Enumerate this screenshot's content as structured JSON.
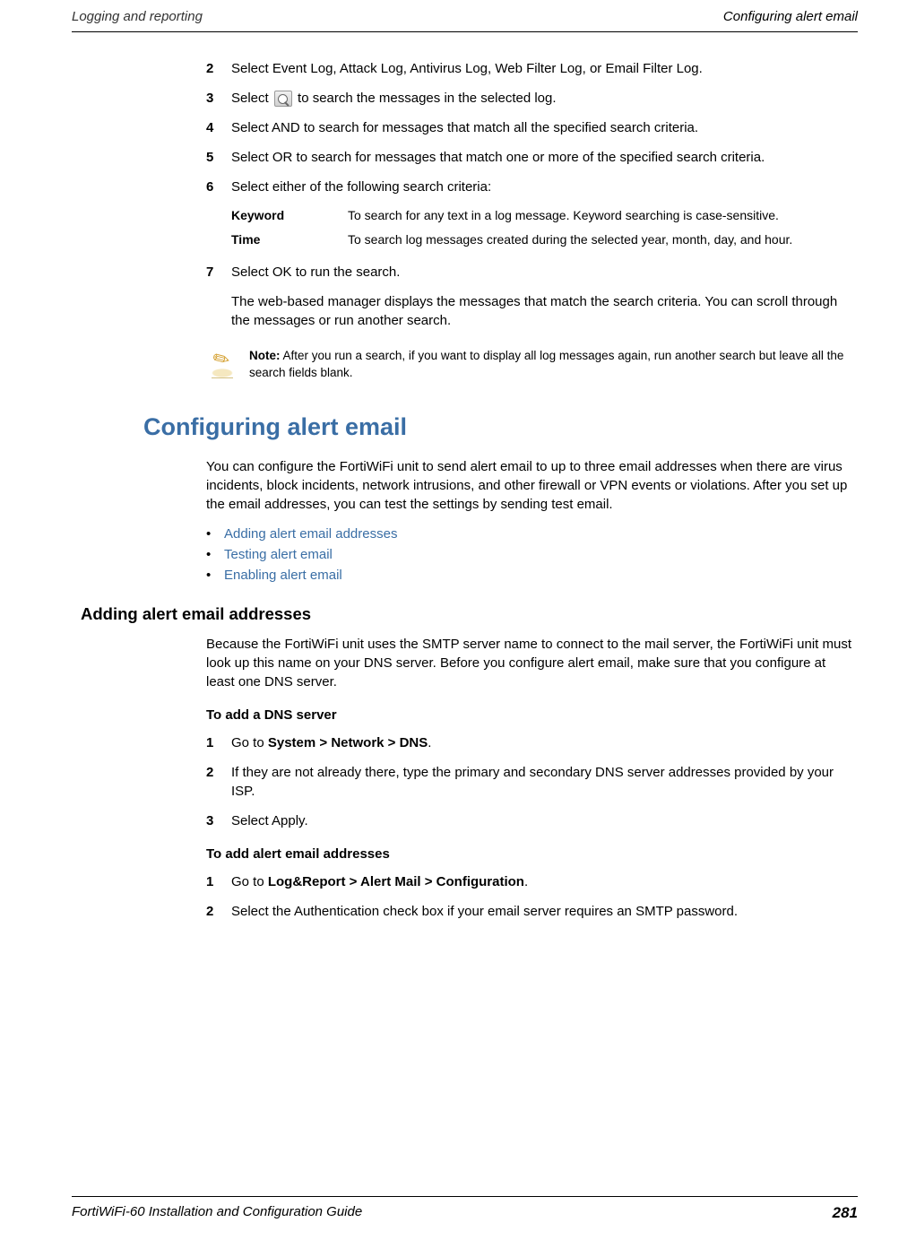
{
  "header": {
    "left": "Logging and reporting",
    "right": "Configuring alert email"
  },
  "steps_top": [
    {
      "num": "2",
      "text": "Select Event Log, Attack Log, Antivirus Log, Web Filter Log, or Email Filter Log."
    },
    {
      "num": "3",
      "text_pre": "Select ",
      "text_post": " to search the messages in the selected log."
    },
    {
      "num": "4",
      "text": "Select AND to search for messages that match all the specified search criteria."
    },
    {
      "num": "5",
      "text": "Select OR to search for messages that match one or more of the specified search criteria."
    },
    {
      "num": "6",
      "text": "Select either of the following search criteria:"
    }
  ],
  "criteria": [
    {
      "label": "Keyword",
      "desc": "To search for any text in a log message. Keyword searching is case-sensitive."
    },
    {
      "label": "Time",
      "desc": "To search log messages created during the selected year, month, day, and hour."
    }
  ],
  "step7": {
    "num": "7",
    "text": "Select OK to run the search.",
    "sub": "The web-based manager displays the messages that match the search criteria. You can scroll through the messages or run another search."
  },
  "note": {
    "label": "Note:",
    "text": " After you run a search, if you want to display all log messages again, run another search but leave all the search fields blank."
  },
  "section": {
    "title": "Configuring alert email",
    "intro": "You can configure the FortiWiFi unit to send alert email to up to three email addresses when there are virus incidents, block incidents, network intrusions, and other firewall or VPN events or violations. After you set up the email addresses, you can test the settings by sending test email.",
    "links": [
      "Adding alert email addresses",
      "Testing alert email",
      "Enabling alert email"
    ]
  },
  "subsection": {
    "title": "Adding alert email addresses",
    "intro": "Because the FortiWiFi unit uses the SMTP server name to connect to the mail server, the FortiWiFi unit must look up this name on your DNS server. Before you configure alert email, make sure that you configure at least one DNS server."
  },
  "proc1": {
    "heading": "To add a DNS server",
    "steps": [
      {
        "num": "1",
        "pre": "Go to ",
        "bold": "System > Network > DNS",
        "post": "."
      },
      {
        "num": "2",
        "text": "If they are not already there, type the primary and secondary DNS server addresses provided by your ISP."
      },
      {
        "num": "3",
        "text": "Select Apply."
      }
    ]
  },
  "proc2": {
    "heading": "To add alert email addresses",
    "steps": [
      {
        "num": "1",
        "pre": "Go to ",
        "bold": "Log&Report > Alert Mail > Configuration",
        "post": "."
      },
      {
        "num": "2",
        "text": "Select the Authentication check box if your email server requires an SMTP password."
      }
    ]
  },
  "footer": {
    "left": "FortiWiFi-60 Installation and Configuration Guide",
    "right": "281"
  }
}
